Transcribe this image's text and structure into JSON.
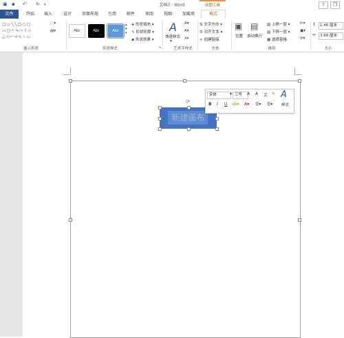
{
  "window": {
    "title": "文档3 - Word",
    "context_label": "绘图工具",
    "help": "?",
    "restore": "❐"
  },
  "quick_access": {
    "save": "💾",
    "undo": "↶",
    "redo": "↻"
  },
  "tabs": [
    "开始",
    "插入",
    "设计",
    "页面布局",
    "引用",
    "邮件",
    "审阅",
    "视图",
    "加载项"
  ],
  "file_tab": "文件",
  "format_tab": "格式",
  "ribbon": {
    "groups": [
      "插入形状",
      "形状样式",
      "艺术字样式",
      "文本",
      "排列",
      "大小"
    ],
    "style_buttons": [
      "Abc",
      "Abc",
      "Abc"
    ],
    "shape_fill": "形状填充",
    "shape_outline": "形状轮廓",
    "shape_effects": "形状效果",
    "quick_styles": "快速样式",
    "text_direction": "文字方向",
    "align_text": "对齐文本",
    "create_link": "创建链接",
    "position": "位置",
    "wrap_text": "自动换行",
    "bring_forward": "上移一层",
    "send_backward": "下移一层",
    "selection_pane": "选择窗格",
    "height": "1.46 厘米",
    "width": "3.68 厘米"
  },
  "canvas": {
    "label": "新建画布"
  },
  "mini_toolbar": {
    "font": "宋体",
    "size": "三号",
    "style_label": "样式",
    "bold": "B",
    "italic": "I",
    "underline": "U"
  },
  "colors": {
    "accent": "#2b579a",
    "context": "#c55a11",
    "shape_fill": "#4472c4"
  }
}
